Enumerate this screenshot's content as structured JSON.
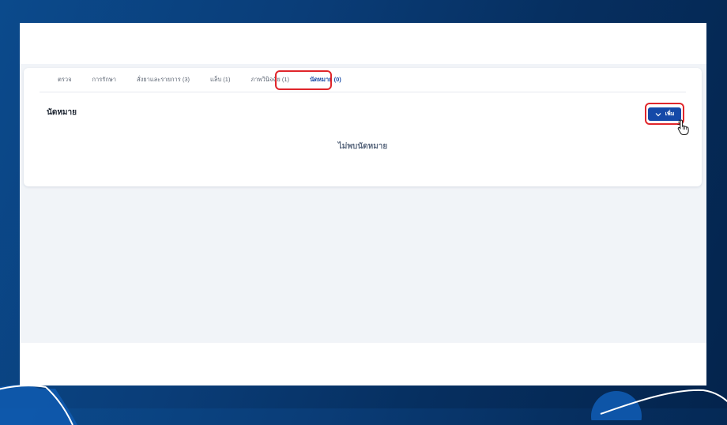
{
  "tabs": [
    {
      "label": "ตรวจ",
      "active": false
    },
    {
      "label": "การรักษา",
      "active": false
    },
    {
      "label": "สั่งยาและรายการ (3)",
      "active": false
    },
    {
      "label": "แล็บ (1)",
      "active": false
    },
    {
      "label": "ภาพวินิจฉัย (1)",
      "active": false
    },
    {
      "label": "นัดหมาย (0)",
      "active": true
    }
  ],
  "section": {
    "title": "นัดหมาย",
    "add_button": {
      "label": "เพิ่ม",
      "icon": "chevron-down-icon"
    },
    "empty_message": "ไม่พบนัดหมาย"
  },
  "colors": {
    "accent": "#1549a8",
    "active_tab": "#1e4fa8",
    "highlight": "#e0262b",
    "background": "#0a3d78",
    "content_bg": "#f1f4f8"
  }
}
